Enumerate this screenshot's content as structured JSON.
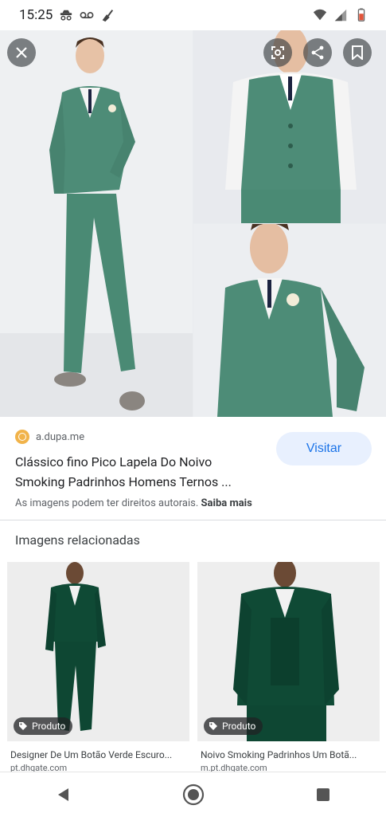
{
  "status_bar": {
    "time": "15:25",
    "icons": [
      "incognito-icon",
      "voicemail-icon",
      "clean-icon"
    ],
    "right_icons": [
      "wifi-icon",
      "signal-icon",
      "battery-icon"
    ]
  },
  "hero_buttons": {
    "close": "close-icon",
    "lens": "lens-icon",
    "share": "share-icon",
    "save": "bookmark-icon"
  },
  "result": {
    "source": "a.dupa.me",
    "title": "Clássico fino Pico Lapela Do Noivo Smoking Padrinhos Homens Ternos ...",
    "visit_label": "Visitar",
    "rights_text": "As imagens podem ter direitos autorais.",
    "learn_more": "Saiba mais"
  },
  "related": {
    "heading": "Imagens relacionadas",
    "items": [
      {
        "badge": "Produto",
        "caption": "Designer De Um Botão Verde Escuro...",
        "domain": "pt.dhgate.com"
      },
      {
        "badge": "Produto",
        "caption": "Noivo Smoking Padrinhos Um Botã...",
        "domain": "m.pt.dhgate.com"
      }
    ]
  },
  "colors": {
    "accent": "#1a73e8",
    "suit_green": "#4d8c77",
    "dark_green": "#0f4a35"
  }
}
